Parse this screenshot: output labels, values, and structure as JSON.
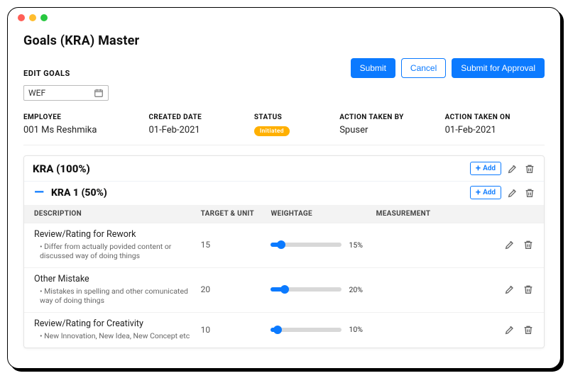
{
  "page": {
    "title": "Goals (KRA) Master",
    "section": "EDIT GOALS"
  },
  "actions": {
    "submit": "Submit",
    "cancel": "Cancel",
    "submit_approval": "Submit for Approval",
    "add": "Add"
  },
  "wef": {
    "value": "WEF"
  },
  "meta": {
    "employee_h": "EMPLOYEE",
    "employee_v": "001 Ms Reshmika",
    "created_h": "CREATED DATE",
    "created_v": "01-Feb-2021",
    "status_h": "STATUS",
    "status_v": "Initiated",
    "actionby_h": "ACTION TAKEN BY",
    "actionby_v": "Spuser",
    "actionon_h": "ACTION TAKEN ON",
    "actionon_v": "01-Feb-2021"
  },
  "group": {
    "title": "KRA (100%)",
    "sub": "KRA 1 (50%)"
  },
  "thead": {
    "desc": "DESCRIPTION",
    "target": "TARGET & UNIT",
    "weight": "WEIGHTAGE",
    "meas": "MEASUREMENT"
  },
  "rows": [
    {
      "title": "Review/Rating for Rework",
      "note": "• Differ from actually povided content or discussed way of doing things",
      "target": "15",
      "pct": 15,
      "pct_label": "15%"
    },
    {
      "title": "Other Mistake",
      "note": "• Mistakes in spelling and other comunicated way of doing things",
      "target": "20",
      "pct": 20,
      "pct_label": "20%"
    },
    {
      "title": "Review/Rating for Creativity",
      "note": "• New Innovation, New Idea, New Concept etc",
      "target": "10",
      "pct": 10,
      "pct_label": "10%"
    }
  ],
  "colors": {
    "primary": "#0b7aff",
    "badge": "#ffb000"
  }
}
